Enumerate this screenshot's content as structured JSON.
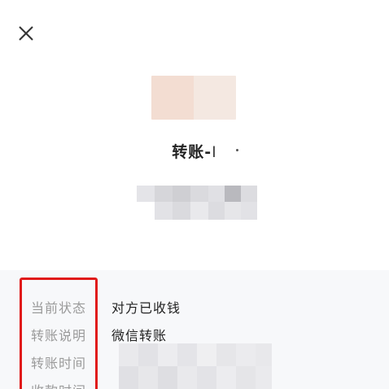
{
  "header": {
    "close_icon": "close-icon"
  },
  "payee": {
    "title": "转账-",
    "title_fragment": "I"
  },
  "details": {
    "rows": [
      {
        "label": "当前状态",
        "value": "对方已收钱"
      },
      {
        "label": "转账说明",
        "value": "微信转账"
      },
      {
        "label": "转账时间",
        "value": ""
      },
      {
        "label": "收款时间",
        "value": ""
      }
    ]
  },
  "colors": {
    "highlight": "#e01a1a",
    "label_gray": "#9a9a9a",
    "text_dark": "#222222",
    "background": "#f7f8fa"
  }
}
